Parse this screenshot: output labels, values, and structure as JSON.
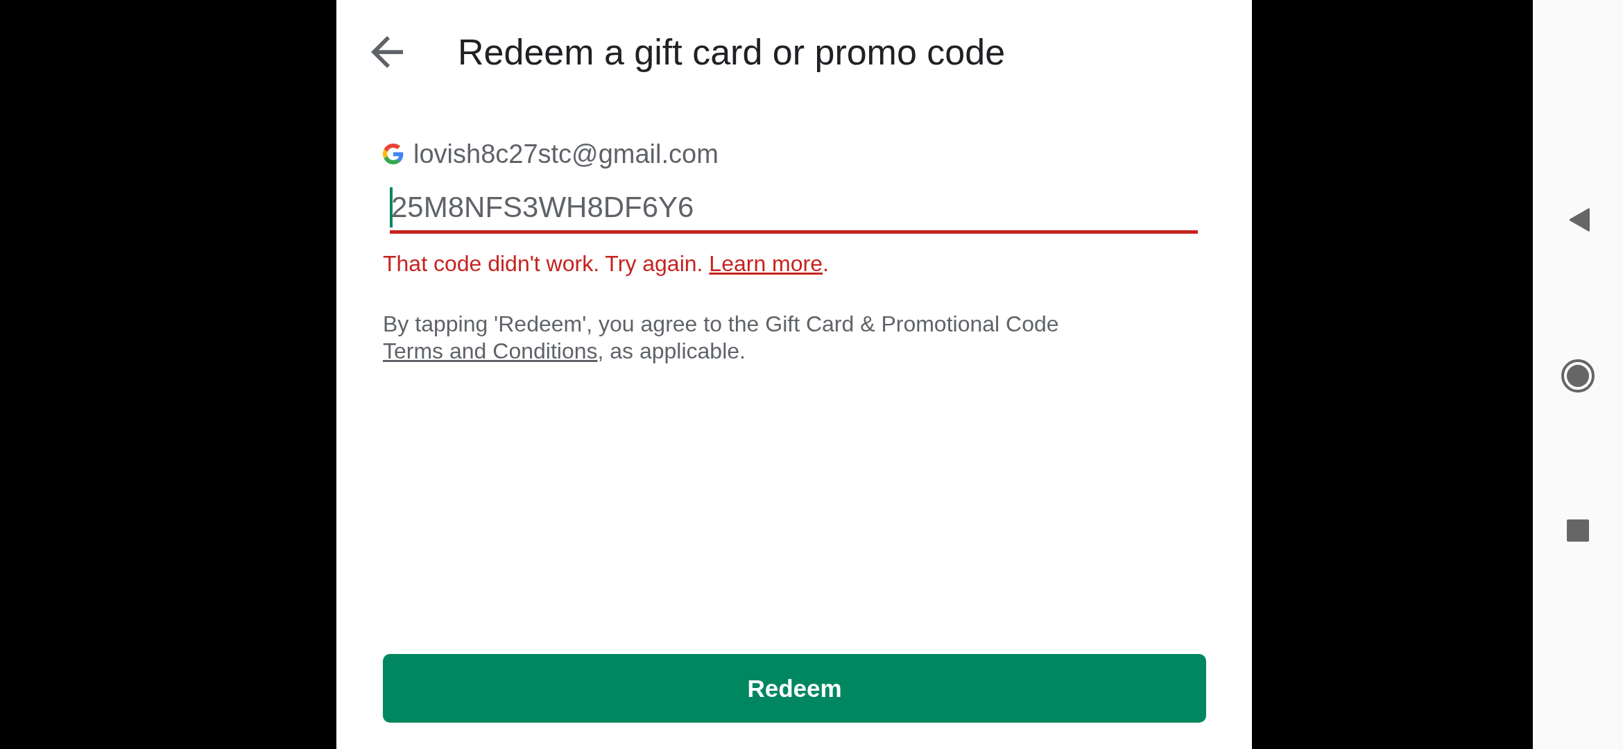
{
  "header": {
    "title": "Redeem a gift card or promo code"
  },
  "account": {
    "email": "lovish8c27stc@gmail.com"
  },
  "code_field": {
    "value": "25M8NFS3WH8DF6Y6",
    "focused": true,
    "error": true
  },
  "error_message": {
    "text": "That code didn't work. Try again. ",
    "link": "Learn more",
    "suffix": "."
  },
  "terms": {
    "text": "By tapping 'Redeem', you agree to the Gift Card & Promotional Code ",
    "link": "Terms and Conditions",
    "suffix": ", as applicable."
  },
  "redeem_button": {
    "label": "Redeem"
  }
}
